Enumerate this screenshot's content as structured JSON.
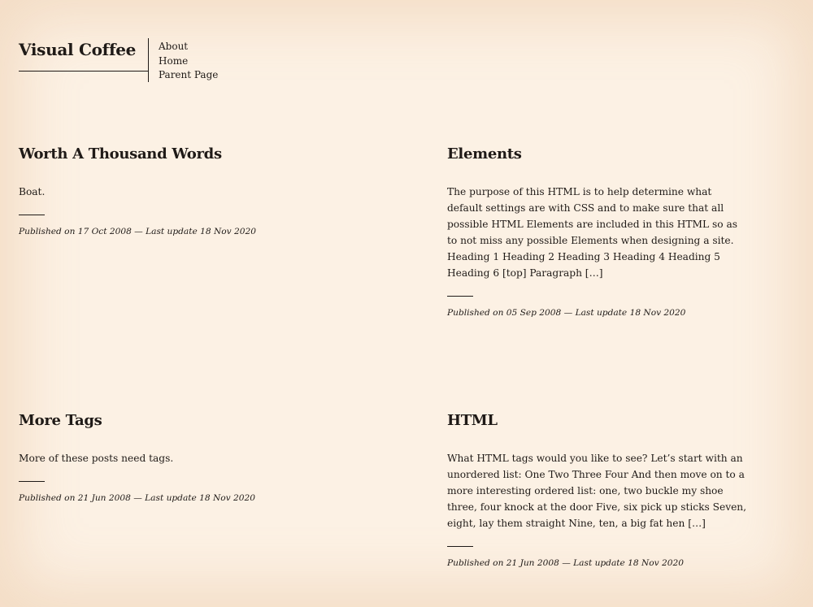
{
  "site": {
    "title": "Visual Coffee"
  },
  "nav": {
    "items": [
      {
        "label": "About"
      },
      {
        "label": "Home"
      },
      {
        "label": "Parent Page"
      }
    ]
  },
  "posts": [
    {
      "title": "Worth A Thousand Words",
      "excerpt": "Boat.",
      "meta": "Published on 17 Oct 2008 — Last update 18 Nov 2020"
    },
    {
      "title": "Elements",
      "excerpt": "The purpose of this HTML is to help determine what default settings are with CSS and to make sure that all possible HTML Elements are included in this HTML so as to not miss any possible Elements when designing a site. Heading 1 Heading 2 Heading 3 Heading 4 Heading 5 Heading 6 [top] Paragraph […]",
      "meta": "Published on 05 Sep 2008 — Last update 18 Nov 2020"
    },
    {
      "title": "More Tags",
      "excerpt": "More of these posts need tags.",
      "meta": "Published on 21 Jun 2008 — Last update 18 Nov 2020"
    },
    {
      "title": "HTML",
      "excerpt": "What HTML tags would you like to see? Let’s start with an unordered list: One Two Three Four And then move on to a more interesting ordered list: one, two buckle my shoe three, four knock at the door Five, six pick up sticks Seven, eight, lay them straight Nine, ten, a big fat hen […]",
      "meta": "Published on 21 Jun 2008 — Last update 18 Nov 2020"
    }
  ],
  "colors": {
    "background": "#fcf1e4",
    "text": "#1f1a17"
  }
}
